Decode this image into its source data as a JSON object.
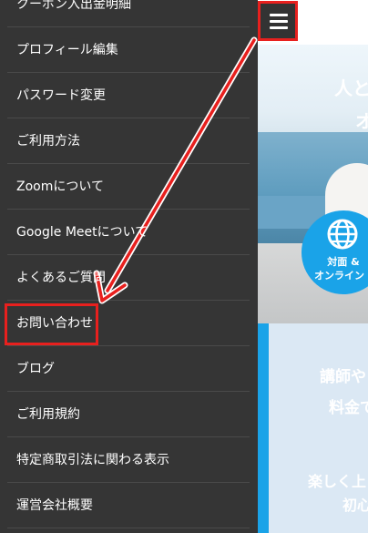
{
  "menu": {
    "items": [
      {
        "label": "クーポン入出金明細"
      },
      {
        "label": "プロフィール編集"
      },
      {
        "label": "パスワード変更"
      },
      {
        "label": "ご利用方法"
      },
      {
        "label": "Zoomについて"
      },
      {
        "label": "Google Meetについて"
      },
      {
        "label": "よくあるご質問"
      },
      {
        "label": "お問い合わせ"
      },
      {
        "label": "ブログ"
      },
      {
        "label": "ご利用規約"
      },
      {
        "label": "特定商取引法に関わる表示"
      },
      {
        "label": "運営会社概要"
      }
    ]
  },
  "hero": {
    "line1": "人と",
    "line2": "オ",
    "badge_line1": "対面 &",
    "badge_line2": "オンライン"
  },
  "lower_section": {
    "line1": "講師や",
    "line2": "料金で",
    "line3": "楽しく上",
    "line4": "初心"
  },
  "colors": {
    "drawer_bg": "#353535",
    "annotation_red": "#e8201e",
    "accent_blue": "#1aa3e8"
  },
  "icons": {
    "hamburger": "hamburger-menu-icon",
    "globe": "globe-icon"
  }
}
